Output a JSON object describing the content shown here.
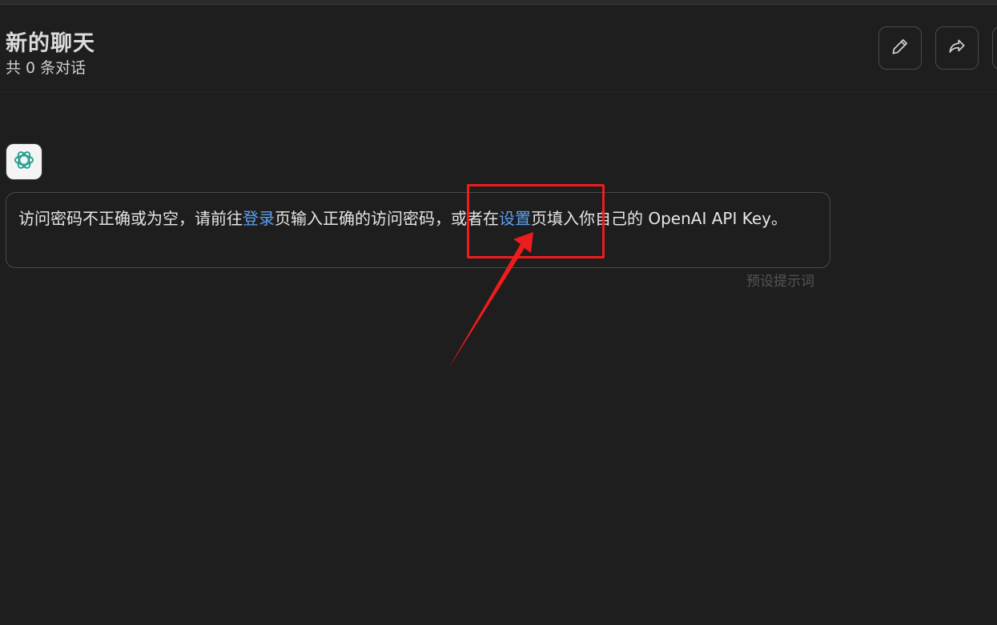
{
  "header": {
    "title": "新的聊天",
    "subtitle": "共 0 条对话"
  },
  "message": {
    "part1": "访问密码不正确或为空，请前往",
    "link_login": "登录",
    "part2": "页输入正确的访问密码，或者在",
    "link_settings": "设置",
    "part3": "页填入你自己的 OpenAI API Key。",
    "hint": "预设提示词"
  },
  "icons": {
    "edit": "pencil-icon",
    "share": "share-icon",
    "avatar": "openai-logo-icon"
  },
  "colors": {
    "background": "#1e1e1e",
    "link": "#5aa0f2",
    "annotation": "#ee1c1c",
    "avatar_logo": "#1f9e8f"
  }
}
